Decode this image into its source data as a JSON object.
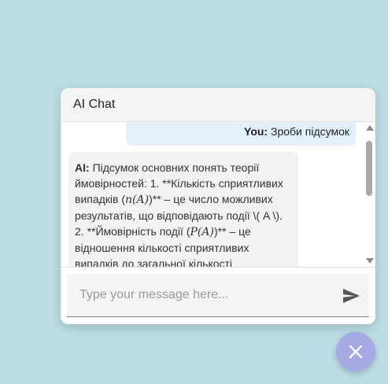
{
  "chat": {
    "title": "AI Chat",
    "messages": [
      {
        "sender": "You:",
        "text": "Зроби підсумок"
      },
      {
        "sender": "AI:",
        "text_1": "Підсумок основних понять теорії ймовірностей: 1. **Кількість сприятливих випадків (",
        "math_1": "n(A)",
        "text_2": ")** – це число можливих результатів, що відповідають події \\( A \\). 2. **Ймовірність події (",
        "math_2": "P(A)",
        "text_3": ")** – це відношення кількості сприятливих випадків до загальної кількості"
      }
    ],
    "input": {
      "value": "",
      "placeholder": "Type your message here..."
    }
  },
  "icons": {
    "send": "send-icon",
    "close": "close-icon",
    "scroll_up": "arrow-up-icon",
    "scroll_down": "arrow-down-icon"
  },
  "colors": {
    "background": "#bcdde4",
    "user_bubble": "#e3f0fb",
    "ai_bubble": "#f2f2f2",
    "fab": "#a7a9e4",
    "send_icon": "#555555"
  }
}
